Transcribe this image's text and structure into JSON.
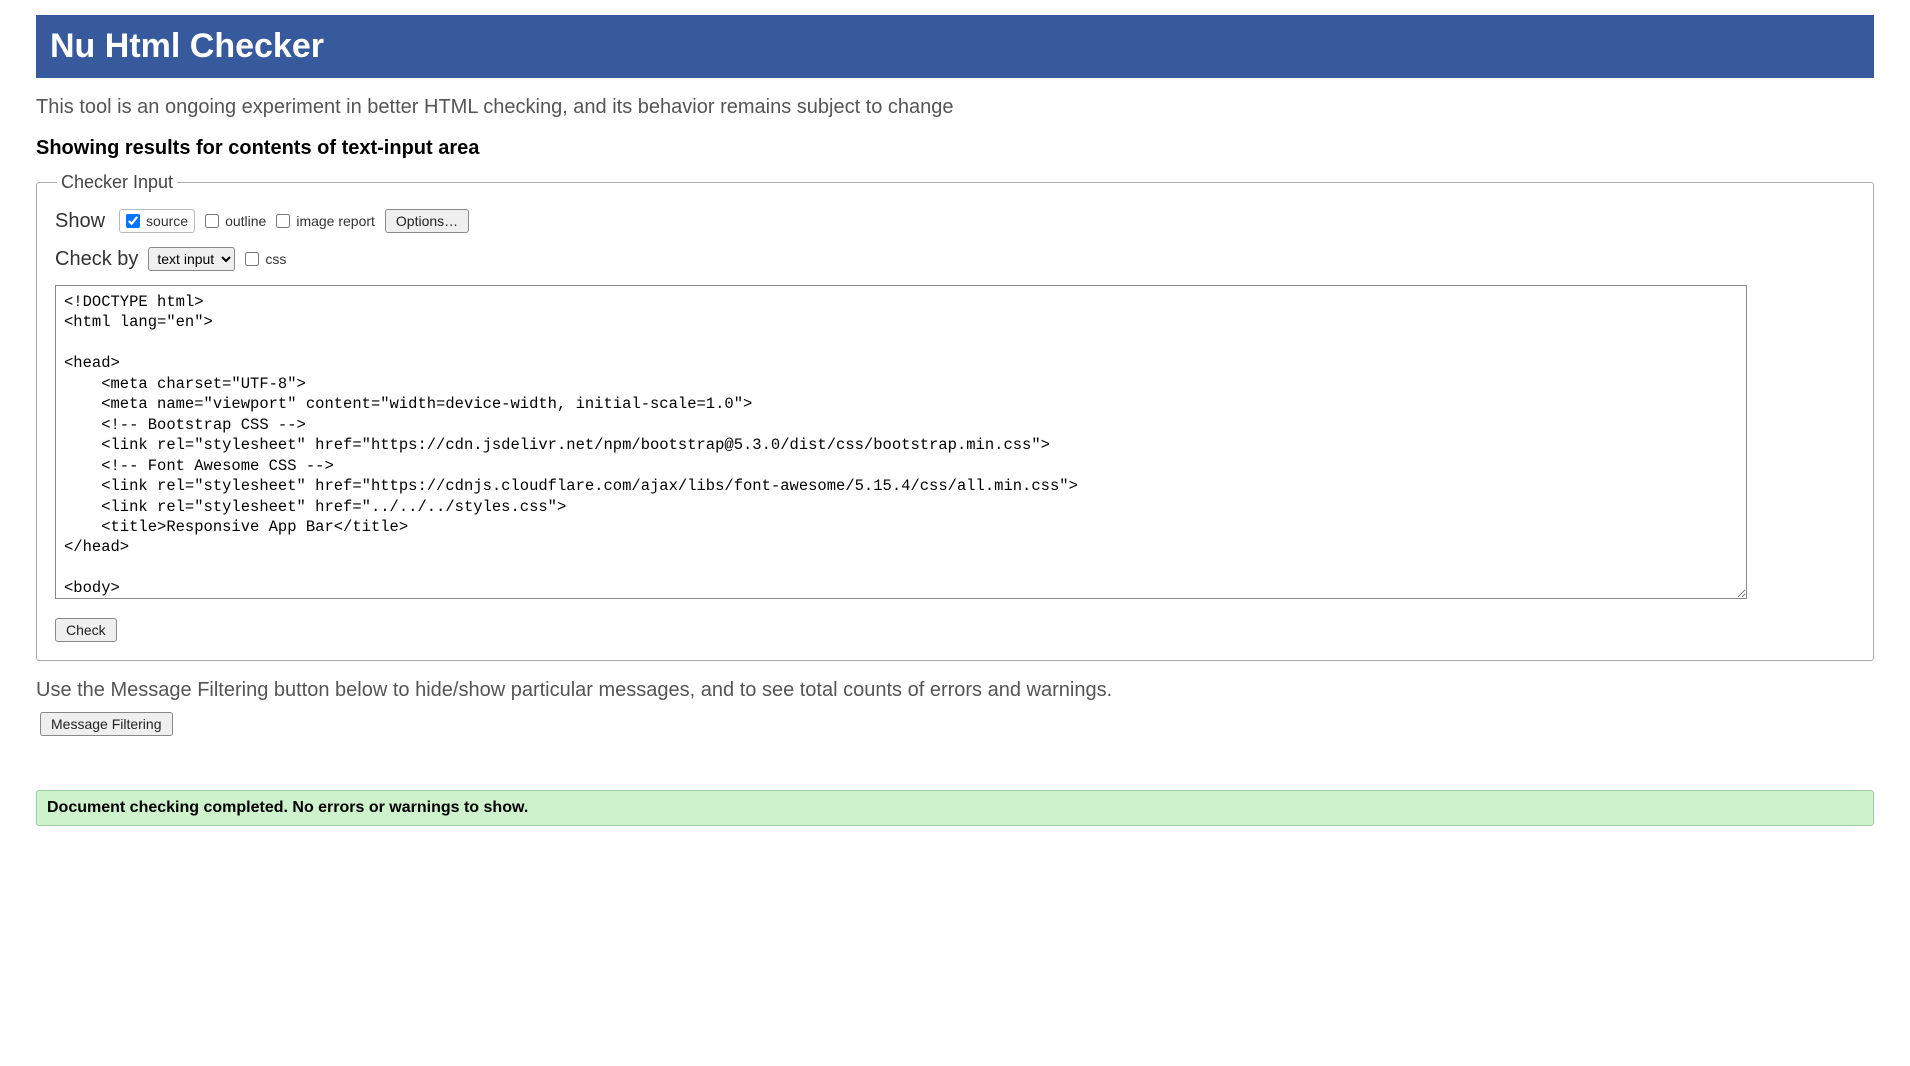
{
  "header": {
    "title": "Nu Html Checker"
  },
  "subtitle": "This tool is an ongoing experiment in better HTML checking, and its behavior remains subject to change",
  "results_heading": "Showing results for contents of text-input area",
  "checker_input": {
    "legend": "Checker Input",
    "show_label": "Show",
    "source_label": "source",
    "outline_label": "outline",
    "image_report_label": "image report",
    "options_label": "Options…",
    "checkby_label": "Check by",
    "checkby_selected": "text input",
    "css_label": "css",
    "textarea_value": "<!DOCTYPE html>\n<html lang=\"en\">\n\n<head>\n    <meta charset=\"UTF-8\">\n    <meta name=\"viewport\" content=\"width=device-width, initial-scale=1.0\">\n    <!-- Bootstrap CSS -->\n    <link rel=\"stylesheet\" href=\"https://cdn.jsdelivr.net/npm/bootstrap@5.3.0/dist/css/bootstrap.min.css\">\n    <!-- Font Awesome CSS -->\n    <link rel=\"stylesheet\" href=\"https://cdnjs.cloudflare.com/ajax/libs/font-awesome/5.15.4/css/all.min.css\">\n    <link rel=\"stylesheet\" href=\"../../../styles.css\">\n    <title>Responsive App Bar</title>\n</head>\n\n<body>",
    "check_button": "Check"
  },
  "filtering": {
    "text": "Use the Message Filtering button below to hide/show particular messages, and to see total counts of errors and warnings.",
    "button": "Message Filtering"
  },
  "success": {
    "message": "Document checking completed. No errors or warnings to show."
  }
}
